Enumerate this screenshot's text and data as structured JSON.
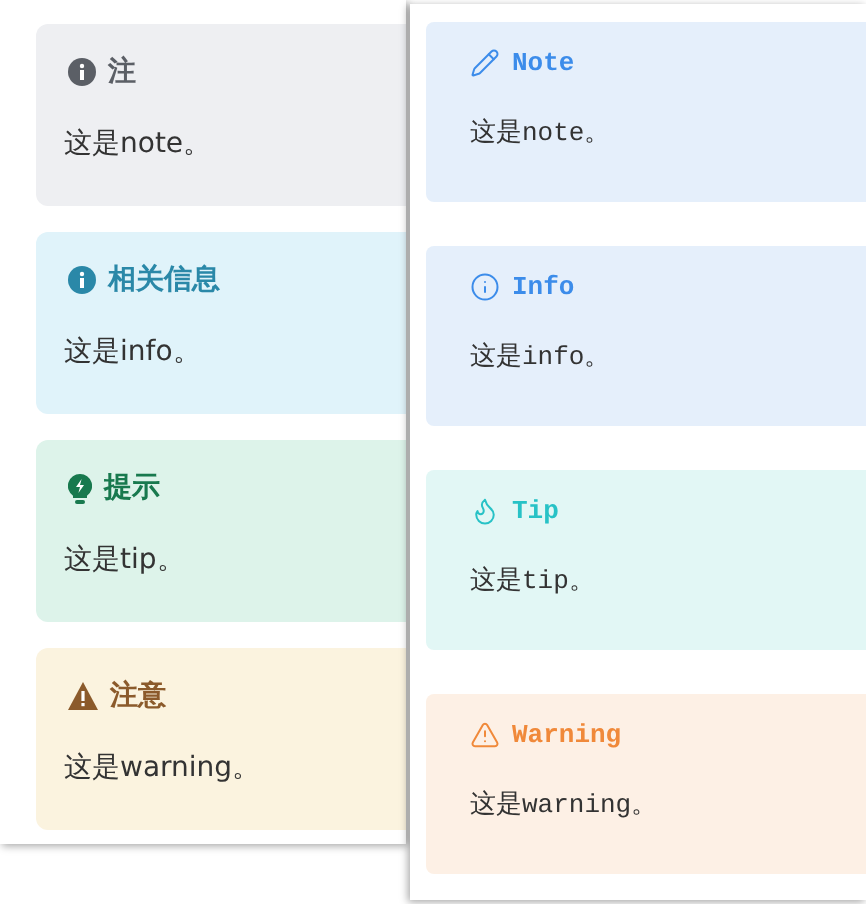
{
  "left_panel": {
    "callouts": [
      {
        "kind": "note",
        "title": "注",
        "body": "这是note。"
      },
      {
        "kind": "info",
        "title": "相关信息",
        "body": "这是info。"
      },
      {
        "kind": "tip",
        "title": "提示",
        "body": "这是tip。"
      },
      {
        "kind": "warning",
        "title": "注意",
        "body": "这是warning。"
      }
    ]
  },
  "right_panel": {
    "callouts": [
      {
        "kind": "note",
        "title": "Note",
        "body": "这是note。"
      },
      {
        "kind": "info",
        "title": "Info",
        "body": "这是info。"
      },
      {
        "kind": "tip",
        "title": "Tip",
        "body": "这是tip。"
      },
      {
        "kind": "warning",
        "title": "Warning",
        "body": "这是warning。"
      }
    ]
  }
}
